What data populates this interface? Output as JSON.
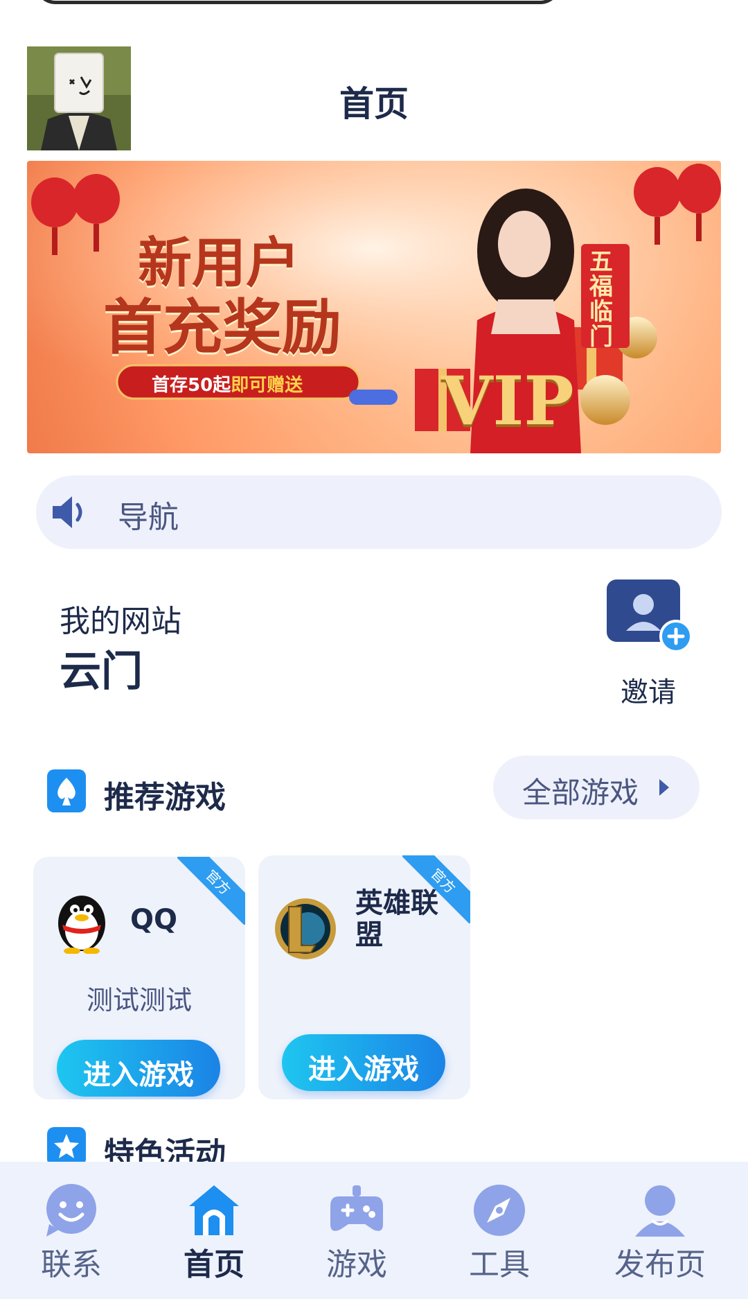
{
  "header": {
    "title": "首页"
  },
  "banner": {
    "headline_line1": "新用户",
    "headline_line2": "首充奖励",
    "promo_pill_prefix": "首存50起",
    "promo_pill_suffix": "即可赠送",
    "vip_text": "VIP",
    "scroll_text": "五福临门"
  },
  "notice": {
    "text": "导航"
  },
  "site": {
    "label": "我的网站",
    "name": "云门"
  },
  "invite": {
    "label": "邀请"
  },
  "recommended": {
    "title": "推荐游戏",
    "all_games_label": "全部游戏",
    "games": [
      {
        "name": "QQ",
        "badge": "官方",
        "description": "测试测试",
        "button_label": "进入游戏"
      },
      {
        "name": "英雄联盟",
        "badge": "官方",
        "description": "",
        "button_label": "进入游戏"
      }
    ]
  },
  "featured": {
    "title": "特色活动"
  },
  "tabbar": {
    "items": [
      {
        "label": "联系",
        "icon": "chat-face-icon"
      },
      {
        "label": "首页",
        "icon": "home-icon"
      },
      {
        "label": "游戏",
        "icon": "gamepad-icon"
      },
      {
        "label": "工具",
        "icon": "compass-icon"
      },
      {
        "label": "发布页",
        "icon": "user-icon"
      }
    ],
    "active_index": 1
  },
  "colors": {
    "accent": "#1b83e6",
    "primary_text": "#1d2a4a",
    "secondary_text": "#4a5680",
    "tab_inactive": "#7d8fd6"
  }
}
